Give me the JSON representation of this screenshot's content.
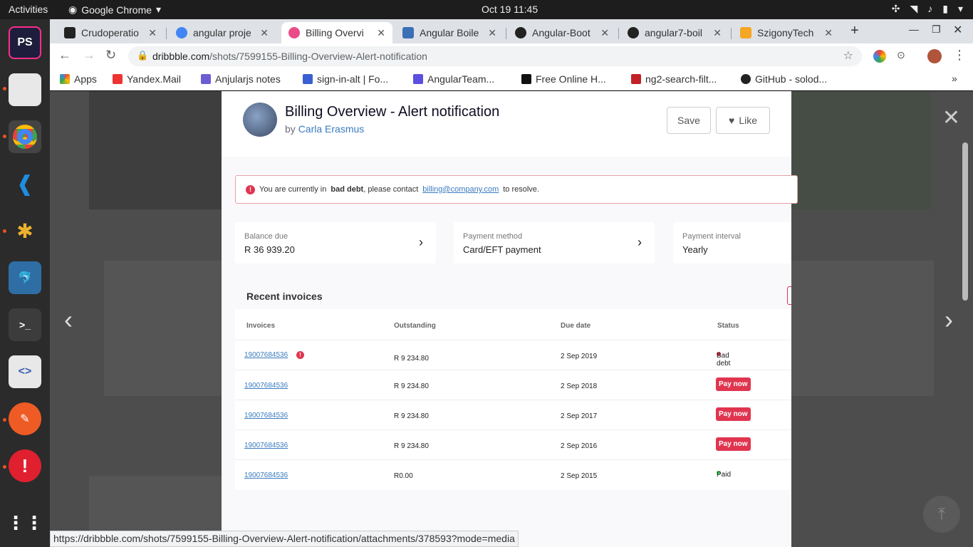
{
  "system": {
    "activities": "Activities",
    "app_name": "Google Chrome",
    "clock": "Oct 19  11:45"
  },
  "tabs": [
    {
      "label": "Crudoperatio",
      "color": "#222"
    },
    {
      "label": "angular proje",
      "color": "#4285f4"
    },
    {
      "label": "Billing Overvi",
      "color": "#ea4c89"
    },
    {
      "label": "Angular Boile",
      "color": "#3b6fb6"
    },
    {
      "label": "Angular-Boot",
      "color": "#222"
    },
    {
      "label": "angular7-boil",
      "color": "#222"
    },
    {
      "label": "SzigonyTech",
      "color": "#f5a623"
    }
  ],
  "address": {
    "domain": "dribbble.com",
    "path": "/shots/7599155-Billing-Overview-Alert-notification"
  },
  "bookmarks": [
    "Apps",
    "Yandex.Mail",
    "Anjularjs notes",
    "sign-in-alt | Fo...",
    "AngularTeam...",
    "Free Online H...",
    "ng2-search-filt...",
    "GitHub - solod..."
  ],
  "shot": {
    "title": "Billing Overview - Alert notification",
    "by_prefix": "by",
    "author": "Carla Erasmus",
    "save": "Save",
    "like": "Like"
  },
  "alert": {
    "text_start": "You are currently in",
    "strong": "bad debt",
    "text_mid": ", please contact",
    "email": "billing@company.com",
    "text_end": "to resolve."
  },
  "cards": [
    {
      "label": "Balance due",
      "value": "R 36 939.20"
    },
    {
      "label": "Payment method",
      "value": "Card/EFT payment"
    },
    {
      "label": "Payment interval",
      "value": "Yearly"
    }
  ],
  "invoices": {
    "title": "Recent invoices",
    "columns": [
      "Invoices",
      "Outstanding",
      "Due date",
      "Status"
    ],
    "rows": [
      {
        "id": "19007684536",
        "outstanding": "R 9 234.80",
        "due": "2 Sep 2019",
        "status": "Bad debt"
      },
      {
        "id": "19007684536",
        "outstanding": "R 9 234.80",
        "due": "2 Sep 2018",
        "status": "Pay now"
      },
      {
        "id": "19007684536",
        "outstanding": "R 9 234.80",
        "due": "2 Sep 2017",
        "status": "Pay now"
      },
      {
        "id": "19007684536",
        "outstanding": "R 9 234.80",
        "due": "2 Sep 2016",
        "status": "Pay now"
      },
      {
        "id": "19007684536",
        "outstanding": "R0.00",
        "due": "2 Sep 2015",
        "status": "Paid"
      }
    ]
  },
  "status_url": "https://dribbble.com/shots/7599155-Billing-Overview-Alert-notification/attachments/378593?mode=media"
}
